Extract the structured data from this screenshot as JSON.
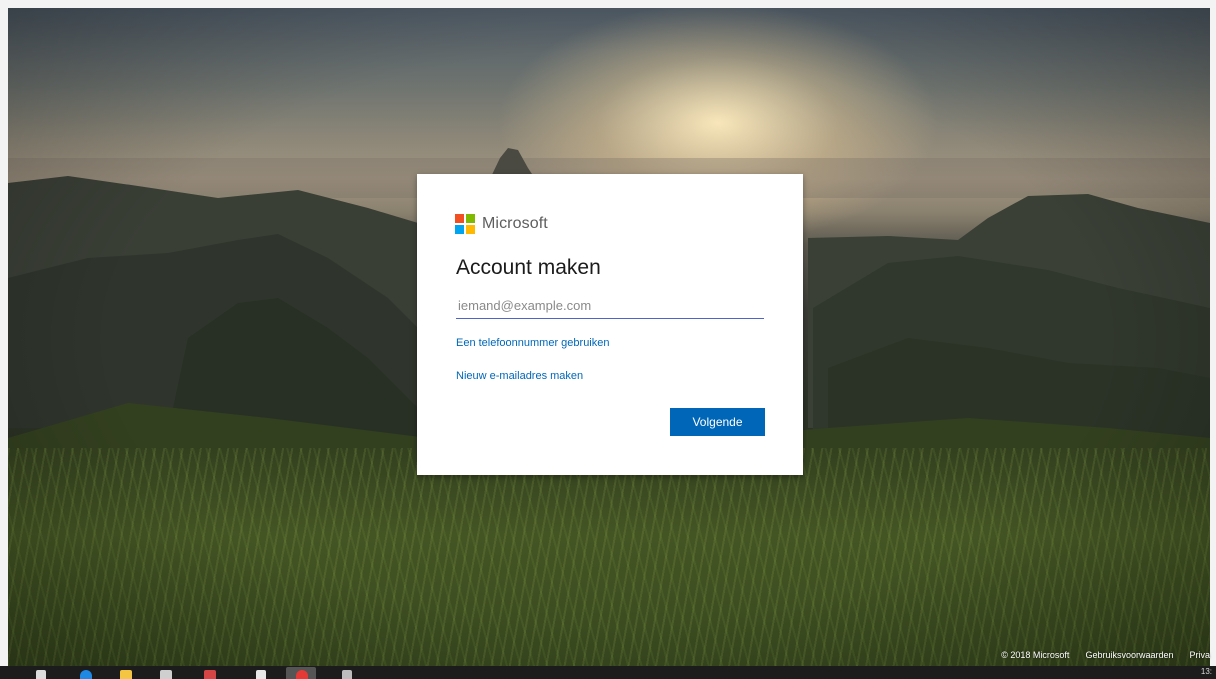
{
  "brand": {
    "name": "Microsoft",
    "colors": {
      "red": "#f25022",
      "green": "#7fba00",
      "blue": "#00a4ef",
      "yellow": "#ffb900",
      "accent": "#0067b8"
    }
  },
  "signup": {
    "title": "Account maken",
    "email_placeholder": "iemand@example.com",
    "email_value": "",
    "phone_link": "Een telefoonnummer gebruiken",
    "new_email_link": "Nieuw e-mailadres maken",
    "next_button": "Volgende"
  },
  "footer": {
    "copyright": "© 2018 Microsoft",
    "terms": "Gebruiksvoorwaarden",
    "privacy": "Priva"
  },
  "taskbar": {
    "icons": [
      "windows-start-icon",
      "edge-icon",
      "file-explorer-icon",
      "store-icon",
      "mail-icon",
      "chrome-icon",
      "opera-icon",
      "app-icon"
    ],
    "time": "13:"
  }
}
